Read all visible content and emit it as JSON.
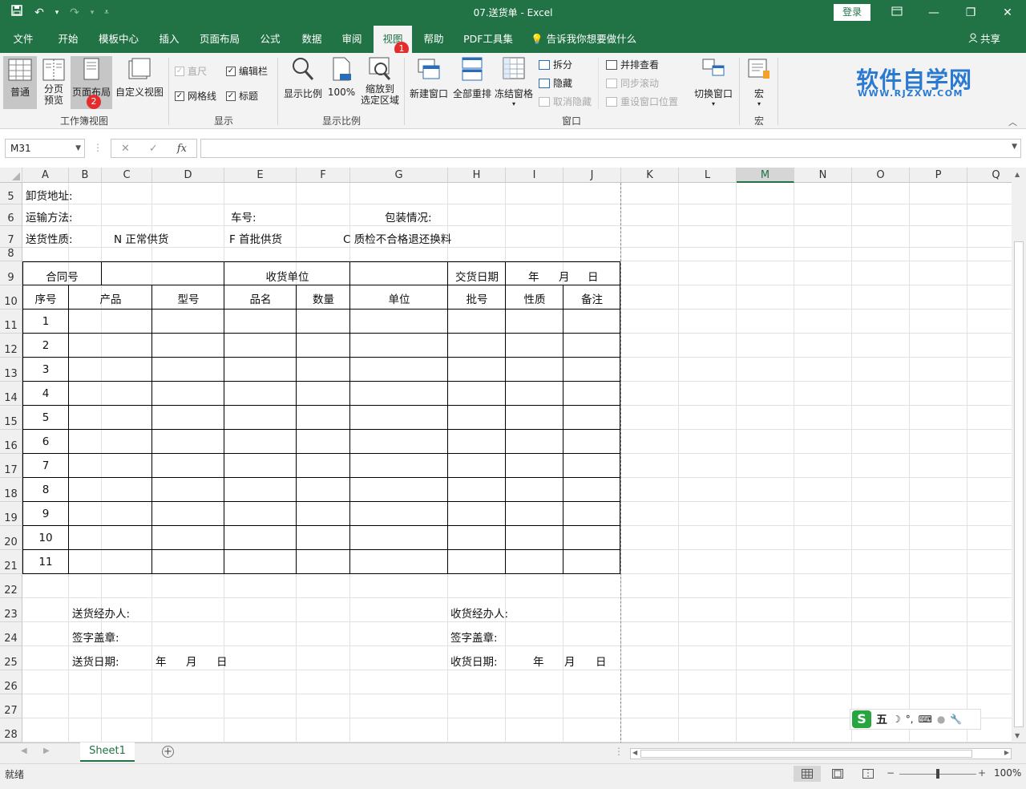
{
  "window": {
    "title": "07.送货单 - Excel",
    "login_label": "登录"
  },
  "menu": {
    "tabs": [
      "文件",
      "开始",
      "模板中心",
      "插入",
      "页面布局",
      "公式",
      "数据",
      "审阅",
      "视图",
      "帮助",
      "PDF工具集"
    ],
    "tell_me": "告诉我你想要做什么",
    "share": "共享",
    "badge1": "1",
    "badge2": "2"
  },
  "ribbon": {
    "workbook_views": {
      "normal": "普通",
      "page_break": "分页\n预览",
      "page_layout": "页面布局",
      "custom": "自定义视图",
      "label": "工作簿视图"
    },
    "show": {
      "ruler": "直尺",
      "formula_bar": "编辑栏",
      "gridlines": "网格线",
      "headings": "标题",
      "label": "显示"
    },
    "zoom": {
      "zoom": "显示比例",
      "hundred": "100%",
      "fit_selection": "缩放到\n选定区域",
      "label": "显示比例"
    },
    "window": {
      "new_window": "新建窗口",
      "arrange_all": "全部重排",
      "freeze": "冻结窗格",
      "split": "拆分",
      "hide": "隐藏",
      "unhide": "取消隐藏",
      "side_by_side": "并排查看",
      "sync_scroll": "同步滚动",
      "reset_position": "重设窗口位置",
      "switch": "切换窗口",
      "label": "窗口"
    },
    "macros": {
      "macro": "宏",
      "label": "宏"
    },
    "logo_main": "软件自学网",
    "logo_sub": "WWW.RJZXW.COM"
  },
  "formula_bar": {
    "name_box": "M31",
    "fx": "fx"
  },
  "grid": {
    "columns": [
      "A",
      "B",
      "C",
      "D",
      "E",
      "F",
      "G",
      "H",
      "I",
      "J",
      "K",
      "L",
      "M",
      "N",
      "O",
      "P",
      "Q"
    ],
    "selected_column": "M",
    "rows": [
      "5",
      "6",
      "7",
      "8",
      "9",
      "10",
      "11",
      "12",
      "13",
      "14",
      "15",
      "16",
      "17",
      "18",
      "19",
      "20",
      "21",
      "22",
      "23",
      "24",
      "25",
      "26",
      "27",
      "28"
    ]
  },
  "form": {
    "unload_address": "卸货地址:",
    "transport": "运输方法:",
    "car_no": "车号:",
    "packing": "包装情况:",
    "delivery_type": "送货性质:",
    "type_n": "N 正常供货",
    "type_f": "F  首批供货",
    "type_c": "C  质检不合格退还换料",
    "contract_no": "合同号",
    "receiver": "收货单位",
    "delivery_date": "交货日期",
    "year": "年",
    "month": "月",
    "day": "日",
    "headers": [
      "序号",
      "产品",
      "型号",
      "品名",
      "数量",
      "单位",
      "批号",
      "性质",
      "备注"
    ],
    "serials": [
      "1",
      "2",
      "3",
      "4",
      "5",
      "6",
      "7",
      "8",
      "9",
      "10",
      "11"
    ],
    "sender_agent": "送货经办人:",
    "sign_stamp": "签字盖章:",
    "send_date": "送货日期:",
    "receiver_agent": "收货经办人:",
    "receive_date": "收货日期:"
  },
  "sheets": {
    "active": "Sheet1"
  },
  "status": {
    "ready": "就绪",
    "zoom": "100%"
  },
  "ime": {
    "mode": "五"
  }
}
